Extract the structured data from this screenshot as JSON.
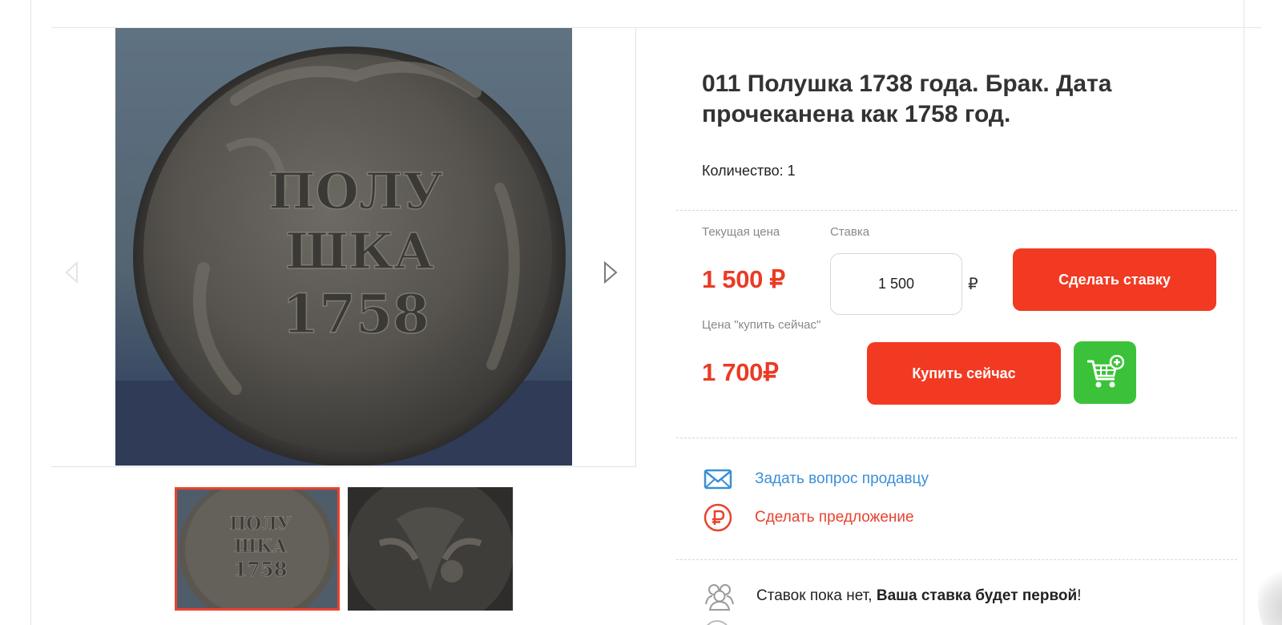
{
  "lot": {
    "title": "011 Полушка 1738 года. Брак. Дата прочеканена как 1758 год.",
    "quantity_label": "Количество: 1"
  },
  "gallery": {
    "coin_text": [
      "ПОЛУ",
      "ШКА",
      "1758"
    ],
    "thumbnail_count": 2
  },
  "pricing": {
    "current_price_label": "Текущая цена",
    "current_price": "1 500 ₽",
    "bid_label": "Ставка",
    "bid_value": "1 500",
    "bid_currency": "₽",
    "place_bid_button": "Сделать ставку",
    "buy_now_label": "Цена \"купить сейчас\"",
    "buy_now_price": "1 700₽",
    "buy_now_button": "Купить сейчас"
  },
  "actions": {
    "ask_seller": "Задать вопрос продавцу",
    "make_offer": "Сделать предложение"
  },
  "bids": {
    "status_prefix": "Ставок пока нет, ",
    "status_bold": "Ваша ставка будет первой",
    "status_suffix": "!"
  },
  "colors": {
    "accent_red": "#f23a22",
    "price_red": "#ea3b24",
    "link_blue": "#3a8fd8",
    "cart_green": "#3cc23a"
  },
  "icons": [
    "expand-icon",
    "chevron-left-icon",
    "chevron-right-icon",
    "cart-add-icon",
    "envelope-icon",
    "ruble-circle-icon",
    "users-icon"
  ]
}
